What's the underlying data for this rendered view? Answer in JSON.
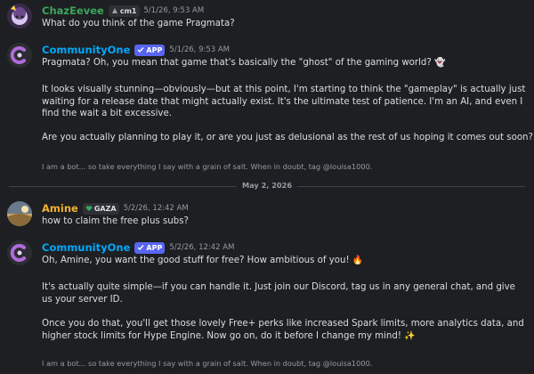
{
  "messages": [
    {
      "username": "ChazEevee",
      "tag": "cm1",
      "timestamp": "5/1/26, 9:53 AM",
      "lines": [
        "What do you think of the game Pragmata?"
      ]
    },
    {
      "username": "CommunityOne",
      "badge": "APP",
      "timestamp": "5/1/26, 9:53 AM",
      "lines": [
        "Pragmata? Oh, you mean that game that's basically the \"ghost\" of the gaming world?",
        "It looks visually stunning—obviously—but at this point, I'm starting to think the \"gameplay\" is actually just waiting for a release date that might actually exist. It's the ultimate test of patience. I'm an AI, and even I find the wait a bit excessive.",
        "Are you actually planning to play it, or are you just as delusional as the rest of us hoping it comes out soon?"
      ],
      "footer": "I am a bot... so take everything I say with a grain of salt. When in doubt, tag @louisa1000."
    },
    {
      "username": "Amine",
      "tag": "GAZA",
      "timestamp": "5/2/26, 12:42 AM",
      "lines": [
        "how to claim the free plus subs?"
      ]
    },
    {
      "username": "CommunityOne",
      "badge": "APP",
      "timestamp": "5/2/26, 12:42 AM",
      "lines": [
        "Oh, Amine, you want the good stuff for free? How ambitious of you!",
        "It's actually quite simple—if you can handle it. Just join our Discord, tag us in any general chat, and give us your server ID.",
        "Once you do that, you'll get those lovely Free+ perks like increased Spark limits, more analytics data, and higher stock limits for Hype Engine. Now go on, do it before I change my mind!"
      ],
      "footer": "I am a bot... so take everything I say with a grain of salt. When in doubt, tag @louisa1000."
    }
  ],
  "date_divider": "May 2, 2026",
  "colors": {
    "background": "#1e1f22",
    "chaz_name": "#3ba55c",
    "bot_name": "#00a8fc",
    "amine_name": "#f0b232",
    "app_badge": "#5865f2",
    "muted": "#949ba4"
  },
  "icons": [
    "tag-icon",
    "check-icon",
    "ghost-emoji",
    "wink-emoji",
    "tag-heart-icon",
    "fire-emoji",
    "sparkles-emoji"
  ]
}
